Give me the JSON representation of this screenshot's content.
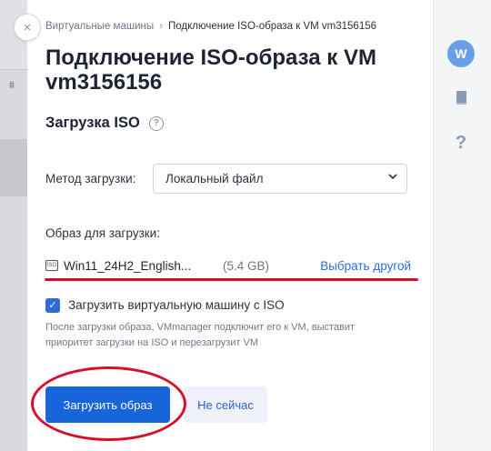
{
  "breadcrumb": {
    "parent": "Виртуальные машины",
    "separator": "›",
    "current": "Подключение ISO-образа к VM vm3156156"
  },
  "title": "Подключение ISO-образа к VM vm3156156",
  "section": {
    "title": "Загрузка ISO",
    "help_icon": "question-circle-icon"
  },
  "form": {
    "method_label": "Метод загрузки:",
    "method_value": "Локальный файл",
    "image_label": "Образ для загрузки:",
    "file_name": "Win11_24H2_English...",
    "file_size": "(5.4 GB)",
    "change_link": "Выбрать другой",
    "checkbox_label": "Загрузить виртуальную машину с ISO",
    "checkbox_checked": true,
    "note": "После загрузки образа, VMmanager подключит его к VM, выставит приоритет загрузки на ISO и перезагрузит VM"
  },
  "buttons": {
    "primary": "Загрузить образ",
    "secondary": "Не сейчас"
  },
  "rail": {
    "avatar_letter": "W",
    "help_glyph": "?"
  },
  "icons": {
    "close": "×",
    "chevron": "⌄",
    "check": "✓",
    "disc": "ISO"
  },
  "colors": {
    "accent": "#1765d8",
    "link": "#2f6bd8",
    "annotation_red": "#d3122a",
    "avatar": "#6a9fe6"
  }
}
